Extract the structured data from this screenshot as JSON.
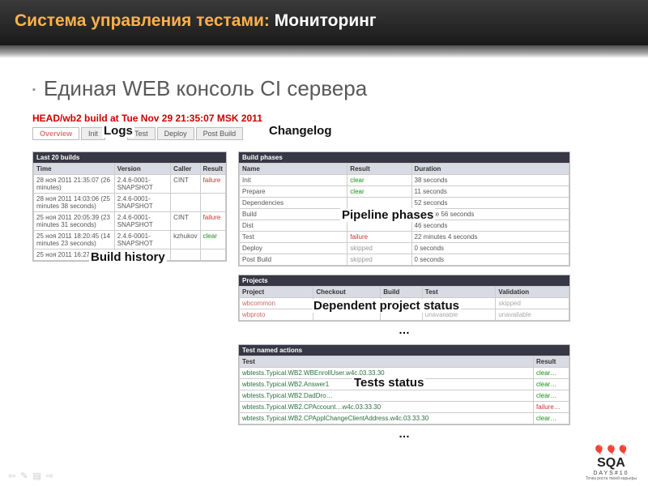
{
  "slide": {
    "title_accent": "Система управления тестами:",
    "title_rest": " Мониторинг",
    "bullet": "Единая WEB консоль CI сервера"
  },
  "build_title": "HEAD/wb2 build at Tue Nov 29 21:35:07 MSK 2011",
  "tabs": [
    "Overview",
    "Init",
    "Logs",
    "Test",
    "Deploy",
    "Post Build",
    "Changelog"
  ],
  "annotations": {
    "logs": "Logs",
    "changelog": "Changelog",
    "build_history": "Build history",
    "pipeline": "Pipeline phases",
    "deps": "Dependent project status",
    "tests": "Tests status",
    "ellipsis": "…"
  },
  "history": {
    "title": "Last 20 builds",
    "cols": [
      "Time",
      "Version",
      "Caller",
      "Result"
    ],
    "rows": [
      {
        "time": "28 ноя 2011 21:35:07 (26 minutes)",
        "version": "2.4.6-0001-SNAPSHOT",
        "caller": "CINT",
        "result": "failure",
        "cls": "failure"
      },
      {
        "time": "28 ноя 2011 14:03:06 (25 minutes 38 seconds)",
        "version": "2.4.6-0001-SNAPSHOT",
        "caller": "",
        "result": "",
        "cls": ""
      },
      {
        "time": "25 ноя 2011 20:05:39 (23 minutes 31 seconds)",
        "version": "2.4.6-0001-SNAPSHOT",
        "caller": "CINT",
        "result": "failure",
        "cls": "failure"
      },
      {
        "time": "25 ноя 2011 18:20:45 (14 minutes 23 seconds)",
        "version": "2.4.6-0001-SNAPSHOT",
        "caller": "kzhukov",
        "result": "clear",
        "cls": "clear"
      },
      {
        "time": "25 ноя 2011 16:27:18",
        "version": "2.4.6-0001-",
        "caller": "",
        "result": "",
        "cls": ""
      }
    ]
  },
  "phases": {
    "title": "Build phases",
    "cols": [
      "Name",
      "Result",
      "Duration"
    ],
    "rows": [
      {
        "name": "Init",
        "result": "clear",
        "cls": "clear",
        "dur": "38 seconds"
      },
      {
        "name": "Prepare",
        "result": "clear",
        "cls": "clear",
        "dur": "11 seconds"
      },
      {
        "name": "Dependencies",
        "result": "",
        "cls": "",
        "dur": "52 seconds"
      },
      {
        "name": "Build",
        "result": "",
        "cls": "",
        "dur": "1 minute 56 seconds"
      },
      {
        "name": "Dist",
        "result": "",
        "cls": "",
        "dur": "46 seconds"
      },
      {
        "name": "Test",
        "result": "failure",
        "cls": "failure",
        "dur": "22 minutes 4 seconds"
      },
      {
        "name": "Deploy",
        "result": "skipped",
        "cls": "skipped",
        "dur": "0 seconds"
      },
      {
        "name": "Post Build",
        "result": "skipped",
        "cls": "skipped",
        "dur": "0 seconds"
      }
    ]
  },
  "projects": {
    "title": "Projects",
    "cols": [
      "Project",
      "Checkout",
      "Build",
      "Test",
      "Validation"
    ],
    "rows": [
      {
        "p": "wbcommon",
        "c": "",
        "b": "",
        "t": "unavailable",
        "v": "skipped"
      },
      {
        "p": "wbproto",
        "c": "",
        "b": "",
        "t": "unavailable",
        "v": "unavailable"
      }
    ]
  },
  "tests": {
    "title": "Test named actions",
    "cols": [
      "Test",
      "Result"
    ],
    "rows": [
      {
        "t": "wbtests.Typical.WB2.WBEnrollUser.w4c.03.33.30",
        "r": "clear…",
        "cls": "clear"
      },
      {
        "t": "wbtests.Typical.WB2.Answer1",
        "r": "clear…",
        "cls": "clear"
      },
      {
        "t": "wbtests.Typical.WB2.DadDro…",
        "r": "clear…",
        "cls": "clear"
      },
      {
        "t": "wbtests.Typical.WB2.CPAccount…w4c.03.33.30",
        "r": "failure…",
        "cls": "failure"
      },
      {
        "t": "wbtests.Typical.WB2.CPApplChangeClientAddress.w4c.03.33.30",
        "r": "clear…",
        "cls": "clear"
      }
    ]
  },
  "logo": {
    "sqa": "SQA",
    "days": "DAYS#10",
    "tag": "Точка роста твоей карьеры"
  }
}
